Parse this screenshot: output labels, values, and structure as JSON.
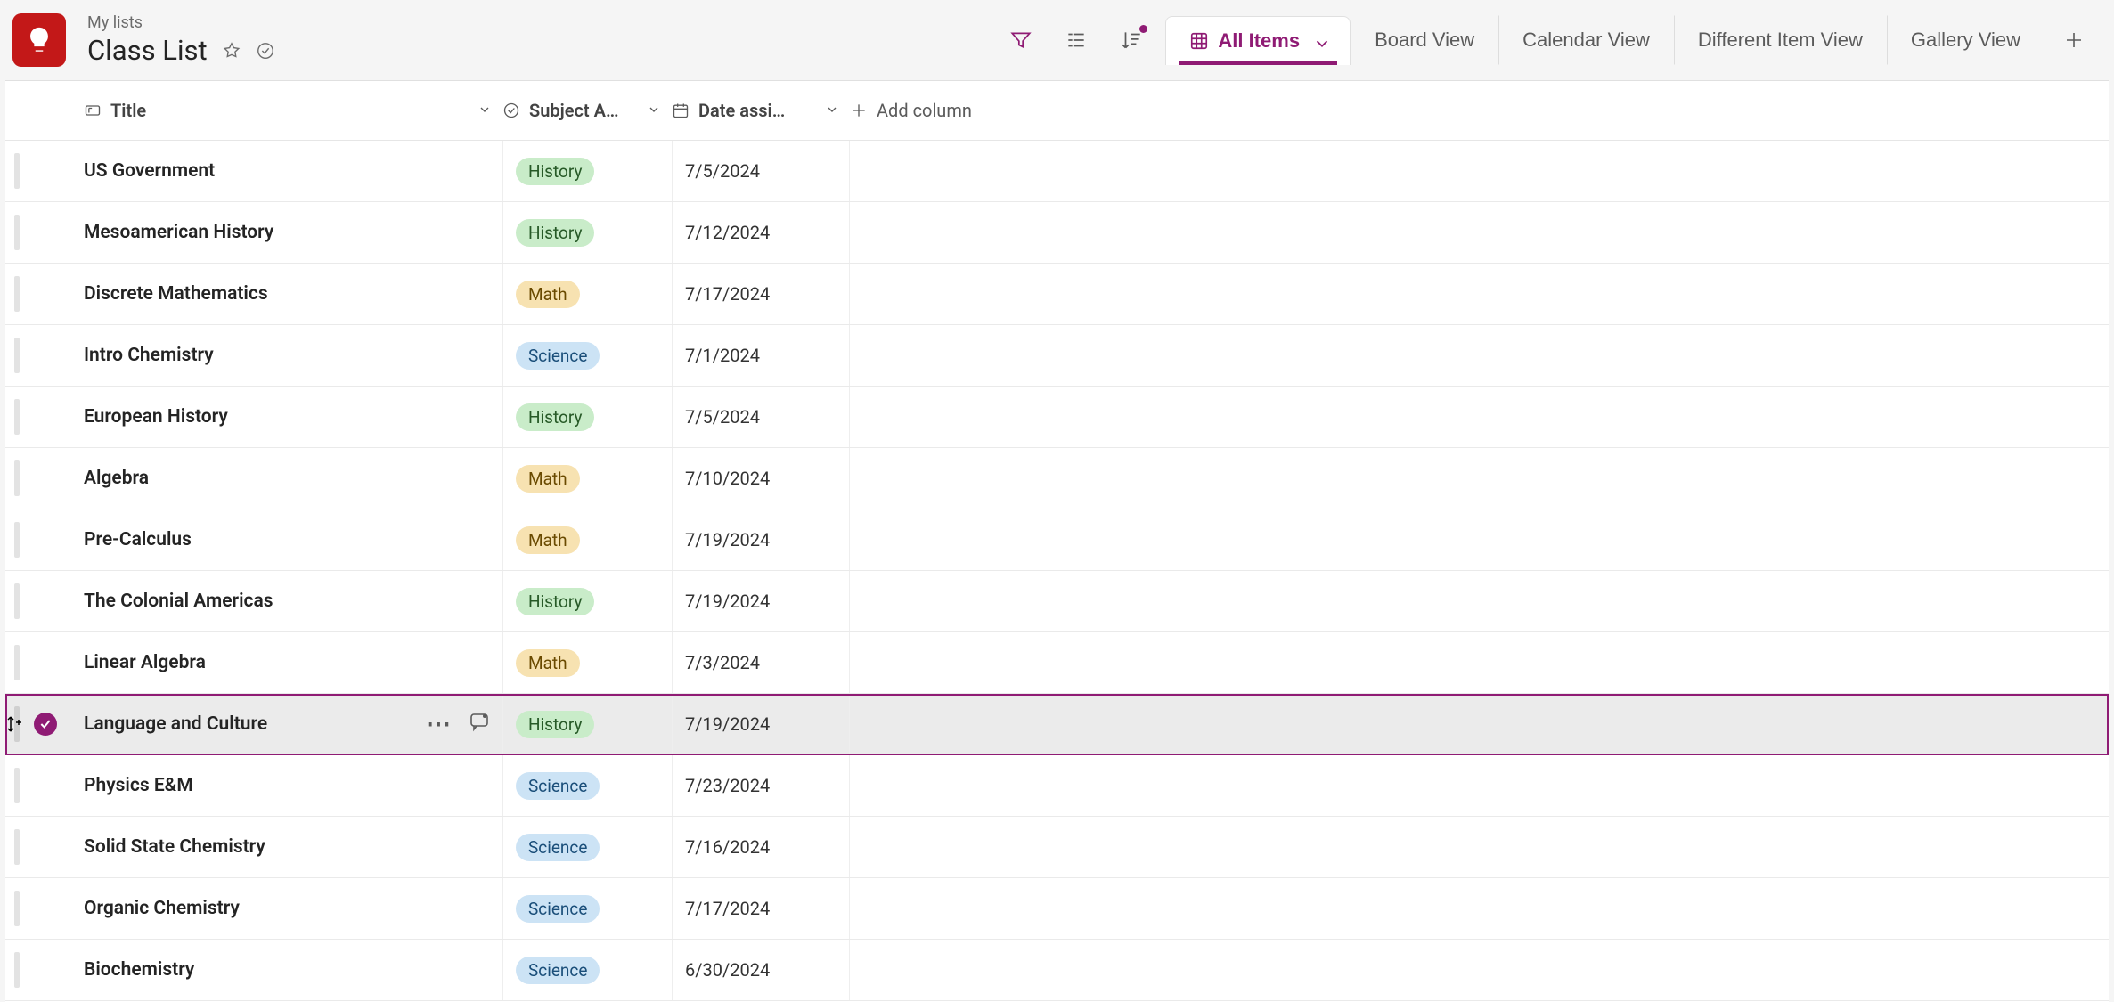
{
  "breadcrumb": "My lists",
  "list_title": "Class List",
  "views": {
    "active": {
      "label": "All Items"
    },
    "others": [
      "Board View",
      "Calendar View",
      "Different Item View",
      "Gallery View"
    ]
  },
  "columns": {
    "title": {
      "label": "Title"
    },
    "subject": {
      "label": "Subject A…"
    },
    "date": {
      "label": "Date assi…"
    },
    "add": {
      "label": "Add column"
    }
  },
  "subject_colors": {
    "History": "#c9ecc9",
    "Math": "#f7e2b1",
    "Science": "#cce3f5"
  },
  "rows": [
    {
      "title": "US Government",
      "subject": "History",
      "date": "7/5/2024",
      "selected": false
    },
    {
      "title": "Mesoamerican History",
      "subject": "History",
      "date": "7/12/2024",
      "selected": false
    },
    {
      "title": "Discrete Mathematics",
      "subject": "Math",
      "date": "7/17/2024",
      "selected": false
    },
    {
      "title": "Intro Chemistry",
      "subject": "Science",
      "date": "7/1/2024",
      "selected": false
    },
    {
      "title": "European History",
      "subject": "History",
      "date": "7/5/2024",
      "selected": false
    },
    {
      "title": "Algebra",
      "subject": "Math",
      "date": "7/10/2024",
      "selected": false
    },
    {
      "title": "Pre-Calculus",
      "subject": "Math",
      "date": "7/19/2024",
      "selected": false
    },
    {
      "title": "The Colonial Americas",
      "subject": "History",
      "date": "7/19/2024",
      "selected": false
    },
    {
      "title": "Linear Algebra",
      "subject": "Math",
      "date": "7/3/2024",
      "selected": false
    },
    {
      "title": "Language and Culture",
      "subject": "History",
      "date": "7/19/2024",
      "selected": true
    },
    {
      "title": "Physics E&M",
      "subject": "Science",
      "date": "7/23/2024",
      "selected": false
    },
    {
      "title": "Solid State Chemistry",
      "subject": "Science",
      "date": "7/16/2024",
      "selected": false
    },
    {
      "title": "Organic Chemistry",
      "subject": "Science",
      "date": "7/17/2024",
      "selected": false
    },
    {
      "title": "Biochemistry",
      "subject": "Science",
      "date": "6/30/2024",
      "selected": false
    }
  ]
}
